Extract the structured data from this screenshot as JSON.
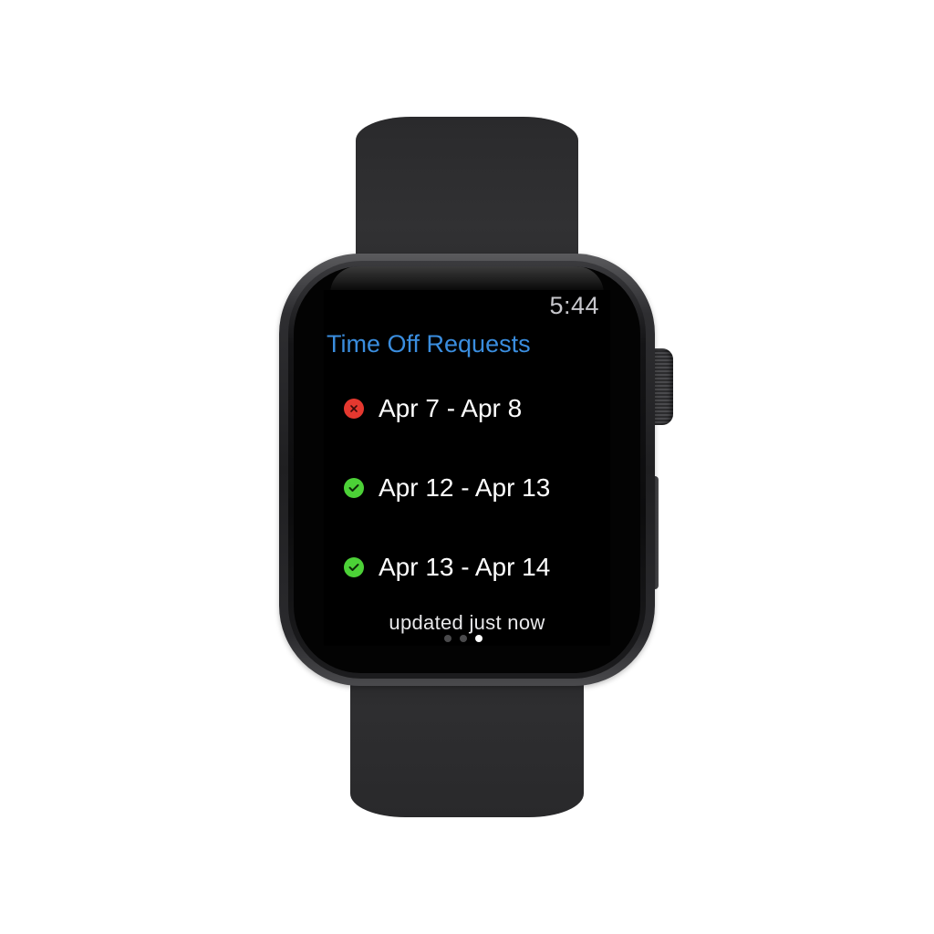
{
  "status_bar": {
    "time": "5:44"
  },
  "screen": {
    "title": "Time Off Requests",
    "requests": [
      {
        "label": "Apr 7 - Apr 8",
        "status": "denied",
        "status_icon": "x-circle-icon",
        "color": "#e5382f"
      },
      {
        "label": "Apr 12 - Apr 13",
        "status": "approved",
        "status_icon": "check-circle-icon",
        "color": "#4cd137"
      },
      {
        "label": "Apr 13 - Apr 14",
        "status": "approved",
        "status_icon": "check-circle-icon",
        "color": "#4cd137"
      }
    ],
    "footer": "updated just now",
    "page_indicator": {
      "pages": 3,
      "current": 3
    }
  },
  "colors": {
    "title": "#3a8dde",
    "background": "#000000",
    "denied": "#e5382f",
    "approved": "#4cd137"
  }
}
